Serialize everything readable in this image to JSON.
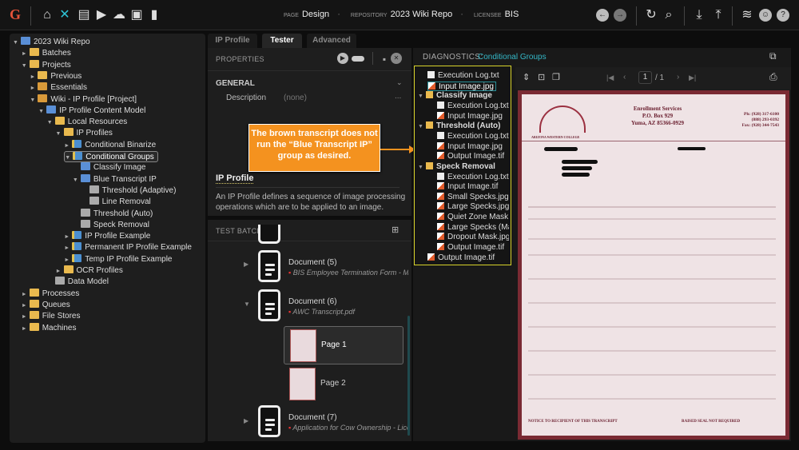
{
  "topbar": {
    "page_label": "PAGE",
    "page": "Design",
    "repo_label": "REPOSITORY",
    "repo": "2023 Wiki Repo",
    "licensee_label": "LICENSEE",
    "licensee": "BIS"
  },
  "tree": [
    {
      "label": "2023 Wiki Repo",
      "depth": 0,
      "arrow": "▼",
      "icon": "b"
    },
    {
      "label": "Batches",
      "depth": 1,
      "arrow": "►",
      "icon": "f"
    },
    {
      "label": "Projects",
      "depth": 1,
      "arrow": "▼",
      "icon": "f"
    },
    {
      "label": "Previous",
      "depth": 2,
      "arrow": "►",
      "icon": "f"
    },
    {
      "label": "Essentials",
      "depth": 2,
      "arrow": "►",
      "icon": "p"
    },
    {
      "label": "Wiki - IP Profile [Project]",
      "depth": 2,
      "arrow": "▼",
      "icon": "p"
    },
    {
      "label": "IP Profile Content Model",
      "depth": 3,
      "arrow": "▼",
      "icon": "b"
    },
    {
      "label": "Local Resources",
      "depth": 4,
      "arrow": "▼",
      "icon": "f"
    },
    {
      "label": "IP Profiles",
      "depth": 5,
      "arrow": "▼",
      "icon": "f"
    },
    {
      "label": "Conditional Binarize",
      "depth": 6,
      "arrow": "►",
      "icon": "ipp"
    },
    {
      "label": "Conditional Groups",
      "depth": 6,
      "arrow": "▼",
      "icon": "ipp",
      "selected": true
    },
    {
      "label": "Classify Image",
      "depth": 7,
      "arrow": "",
      "icon": "b"
    },
    {
      "label": "Blue Transcript IP",
      "depth": 7,
      "arrow": "▼",
      "icon": "b"
    },
    {
      "label": "Threshold (Adaptive)",
      "depth": 8,
      "arrow": "",
      "icon": "st"
    },
    {
      "label": "Line Removal",
      "depth": 8,
      "arrow": "",
      "icon": "st"
    },
    {
      "label": "Threshold (Auto)",
      "depth": 7,
      "arrow": "",
      "icon": "st"
    },
    {
      "label": "Speck Removal",
      "depth": 7,
      "arrow": "",
      "icon": "st"
    },
    {
      "label": "IP Profile Example",
      "depth": 6,
      "arrow": "►",
      "icon": "ipp"
    },
    {
      "label": "Permanent IP Profile Example",
      "depth": 6,
      "arrow": "►",
      "icon": "ipp"
    },
    {
      "label": "Temp IP Profile Example",
      "depth": 6,
      "arrow": "►",
      "icon": "ipp"
    },
    {
      "label": "OCR Profiles",
      "depth": 5,
      "arrow": "►",
      "icon": "f"
    },
    {
      "label": "Data Model",
      "depth": 4,
      "arrow": "",
      "icon": "st"
    },
    {
      "label": "Processes",
      "depth": 1,
      "arrow": "►",
      "icon": "f"
    },
    {
      "label": "Queues",
      "depth": 1,
      "arrow": "►",
      "icon": "f"
    },
    {
      "label": "File Stores",
      "depth": 1,
      "arrow": "►",
      "icon": "f"
    },
    {
      "label": "Machines",
      "depth": 1,
      "arrow": "►",
      "icon": "f"
    }
  ],
  "tabs": [
    "IP Profile",
    "Tester",
    "Advanced"
  ],
  "properties": {
    "title": "PROPERTIES",
    "section": "GENERAL",
    "desc_label": "Description",
    "desc_value": "(none)",
    "more": "..."
  },
  "help": {
    "title": "IP Profile",
    "text": "An IP Profile defines a sequence of image processing operations which are to be applied to an image."
  },
  "callout": "The brown transcript does not run the “Blue Transcript IP” group as desired.",
  "test_batch": {
    "title": "TEST BATCH",
    "docs": [
      {
        "name": "Document (5)",
        "file": "BIS Employee Termination Form - Matt F"
      },
      {
        "name": "Document (6)",
        "file": "AWC Transcript.pdf"
      },
      {
        "name": "Document (7)",
        "file": "Application for Cow Ownership - License"
      }
    ],
    "pages": [
      "Page 1",
      "Page 2"
    ]
  },
  "diagnostics": {
    "label": "DIAGNOSTICS:",
    "target": "Conditional Groups",
    "items": [
      {
        "label": "Execution Log.txt",
        "depth": 0,
        "icon": "txt"
      },
      {
        "label": "Input Image.jpg",
        "depth": 0,
        "icon": "img",
        "selected": true
      },
      {
        "label": "Classify Image",
        "depth": 0,
        "icon": "f",
        "folder": true
      },
      {
        "label": "Execution Log.txt",
        "depth": 1,
        "icon": "txt"
      },
      {
        "label": "Input Image.jpg",
        "depth": 1,
        "icon": "img"
      },
      {
        "label": "Threshold (Auto)",
        "depth": 0,
        "icon": "f",
        "folder": true
      },
      {
        "label": "Execution Log.txt",
        "depth": 1,
        "icon": "txt"
      },
      {
        "label": "Input Image.jpg",
        "depth": 1,
        "icon": "img"
      },
      {
        "label": "Output Image.tif",
        "depth": 1,
        "icon": "img"
      },
      {
        "label": "Speck Removal",
        "depth": 0,
        "icon": "f",
        "folder": true
      },
      {
        "label": "Execution Log.txt",
        "depth": 1,
        "icon": "txt"
      },
      {
        "label": "Input Image.tif",
        "depth": 1,
        "icon": "img"
      },
      {
        "label": "Small Specks.jpg",
        "depth": 1,
        "icon": "img"
      },
      {
        "label": "Large Specks.jpg",
        "depth": 1,
        "icon": "img"
      },
      {
        "label": "Quiet Zone Mask.jpg",
        "depth": 1,
        "icon": "img"
      },
      {
        "label": "Large Specks (Mask)",
        "depth": 1,
        "icon": "img"
      },
      {
        "label": "Dropout Mask.jpg",
        "depth": 1,
        "icon": "img"
      },
      {
        "label": "Output Image.tif",
        "depth": 1,
        "icon": "img"
      },
      {
        "label": "Output Image.tif",
        "depth": 0,
        "icon": "img"
      }
    ]
  },
  "viewer": {
    "page": "1",
    "total": "/ 1"
  },
  "transcript": {
    "office": "Enrollment Services",
    "box": "P.O. Box 929",
    "city": "Yuma, AZ 85366-0929",
    "ph1": "Ph: (928) 317-6100",
    "ph2": "(888) 293-0392",
    "fax": "Fax: (928) 344-7543",
    "college": "ARIZONA WESTERN COLLEGE",
    "notice": "NOTICE TO RECIPIENT OF THIS TRANSCRIPT",
    "seal": "RAISED SEAL NOT REQUIRED"
  }
}
